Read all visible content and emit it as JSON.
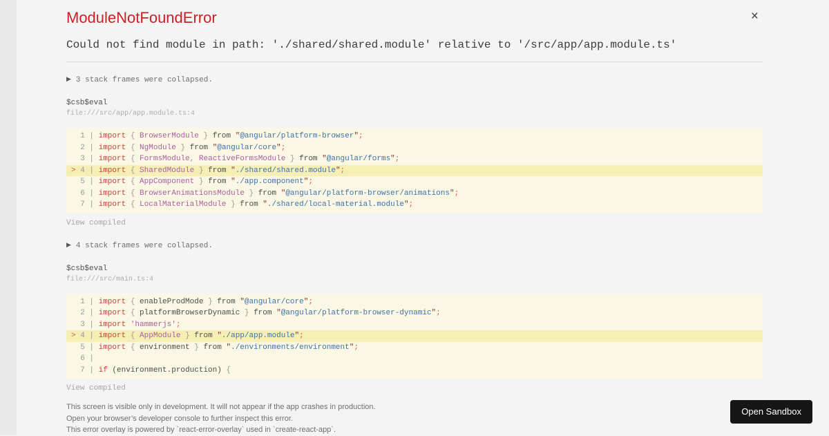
{
  "icons": {
    "collapse_arrow": "▶",
    "close": "×"
  },
  "colors": {
    "title_red": "#ca2026",
    "code_background": "#faf7e4",
    "code_highlight_line": "#f5eeb5",
    "keyword": "#c8423d",
    "type_identifier": "#a9609f",
    "string_content": "#3d72aa",
    "string_quote": "#7e3a30",
    "punctuation_red": "#e0574a",
    "button_background": "#161616"
  },
  "header": {
    "title": "ModuleNotFoundError"
  },
  "message": "Could not find module in path: './shared/shared.module' relative to '/src/app/app.module.ts'",
  "frames": [
    {
      "collapsed_note": "3 stack frames were collapsed.",
      "function_name": "$csb$eval",
      "location": "file:///src/app/app.module.ts:4",
      "view_compiled_label": "View compiled",
      "code": {
        "highlight_line": 4,
        "lines": [
          {
            "hl": false,
            "tokens": [
              [
                "g",
                "  1 | "
              ],
              [
                "k",
                "import"
              ],
              [
                "p",
                " "
              ],
              [
                "g",
                "{"
              ],
              [
                "p",
                " "
              ],
              [
                "t",
                "BrowserModule"
              ],
              [
                "p",
                " "
              ],
              [
                "g",
                "}"
              ],
              [
                "p",
                " from "
              ],
              [
                "q",
                "\""
              ],
              [
                "s",
                "@angular/platform-browser"
              ],
              [
                "q",
                "\""
              ],
              [
                "x",
                ";"
              ]
            ]
          },
          {
            "hl": false,
            "tokens": [
              [
                "g",
                "  2 | "
              ],
              [
                "k",
                "import"
              ],
              [
                "p",
                " "
              ],
              [
                "g",
                "{"
              ],
              [
                "p",
                " "
              ],
              [
                "t",
                "NgModule"
              ],
              [
                "p",
                " "
              ],
              [
                "g",
                "}"
              ],
              [
                "p",
                " from "
              ],
              [
                "q",
                "\""
              ],
              [
                "s",
                "@angular/core"
              ],
              [
                "q",
                "\""
              ],
              [
                "x",
                ";"
              ]
            ]
          },
          {
            "hl": false,
            "tokens": [
              [
                "g",
                "  3 | "
              ],
              [
                "k",
                "import"
              ],
              [
                "p",
                " "
              ],
              [
                "g",
                "{"
              ],
              [
                "p",
                " "
              ],
              [
                "t",
                "FormsModule"
              ],
              [
                "g",
                ","
              ],
              [
                "p",
                " "
              ],
              [
                "t",
                "ReactiveFormsModule"
              ],
              [
                "p",
                " "
              ],
              [
                "g",
                "}"
              ],
              [
                "p",
                " from "
              ],
              [
                "q",
                "\""
              ],
              [
                "s",
                "@angular/forms"
              ],
              [
                "q",
                "\""
              ],
              [
                "x",
                ";"
              ]
            ]
          },
          {
            "hl": true,
            "tokens": [
              [
                "x",
                "> "
              ],
              [
                "g",
                "4 | "
              ],
              [
                "k",
                "import"
              ],
              [
                "p",
                " "
              ],
              [
                "g",
                "{"
              ],
              [
                "p",
                " "
              ],
              [
                "t",
                "SharedModule"
              ],
              [
                "p",
                " "
              ],
              [
                "g",
                "}"
              ],
              [
                "p",
                " from "
              ],
              [
                "q",
                "\""
              ],
              [
                "s",
                "./shared/shared.module"
              ],
              [
                "q",
                "\""
              ],
              [
                "x",
                ";"
              ]
            ]
          },
          {
            "hl": false,
            "tokens": [
              [
                "g",
                "  5 | "
              ],
              [
                "k",
                "import"
              ],
              [
                "p",
                " "
              ],
              [
                "g",
                "{"
              ],
              [
                "p",
                " "
              ],
              [
                "t",
                "AppComponent"
              ],
              [
                "p",
                " "
              ],
              [
                "g",
                "}"
              ],
              [
                "p",
                " from "
              ],
              [
                "q",
                "\""
              ],
              [
                "s",
                "./app.component"
              ],
              [
                "q",
                "\""
              ],
              [
                "x",
                ";"
              ]
            ]
          },
          {
            "hl": false,
            "tokens": [
              [
                "g",
                "  6 | "
              ],
              [
                "k",
                "import"
              ],
              [
                "p",
                " "
              ],
              [
                "g",
                "{"
              ],
              [
                "p",
                " "
              ],
              [
                "t",
                "BrowserAnimationsModule"
              ],
              [
                "p",
                " "
              ],
              [
                "g",
                "}"
              ],
              [
                "p",
                " from "
              ],
              [
                "q",
                "\""
              ],
              [
                "s",
                "@angular/platform-browser/animations"
              ],
              [
                "q",
                "\""
              ],
              [
                "x",
                ";"
              ]
            ]
          },
          {
            "hl": false,
            "tokens": [
              [
                "g",
                "  7 | "
              ],
              [
                "k",
                "import"
              ],
              [
                "p",
                " "
              ],
              [
                "g",
                "{"
              ],
              [
                "p",
                " "
              ],
              [
                "t",
                "LocalMaterialModule"
              ],
              [
                "p",
                " "
              ],
              [
                "g",
                "}"
              ],
              [
                "p",
                " from "
              ],
              [
                "q",
                "\""
              ],
              [
                "s",
                "./shared/local-material.module"
              ],
              [
                "q",
                "\""
              ],
              [
                "x",
                ";"
              ]
            ]
          }
        ]
      }
    },
    {
      "collapsed_note": "4 stack frames were collapsed.",
      "function_name": "$csb$eval",
      "location": "file:///src/main.ts:4",
      "view_compiled_label": "View compiled",
      "code": {
        "highlight_line": 4,
        "lines": [
          {
            "hl": false,
            "tokens": [
              [
                "g",
                "  1 | "
              ],
              [
                "k",
                "import"
              ],
              [
                "p",
                " "
              ],
              [
                "g",
                "{"
              ],
              [
                "p",
                " enableProdMode "
              ],
              [
                "g",
                "}"
              ],
              [
                "p",
                " from "
              ],
              [
                "q",
                "\""
              ],
              [
                "s",
                "@angular/core"
              ],
              [
                "q",
                "\""
              ],
              [
                "x",
                ";"
              ]
            ]
          },
          {
            "hl": false,
            "tokens": [
              [
                "g",
                "  2 | "
              ],
              [
                "k",
                "import"
              ],
              [
                "p",
                " "
              ],
              [
                "g",
                "{"
              ],
              [
                "p",
                " platformBrowserDynamic "
              ],
              [
                "g",
                "}"
              ],
              [
                "p",
                " from "
              ],
              [
                "q",
                "\""
              ],
              [
                "s",
                "@angular/platform-browser-dynamic"
              ],
              [
                "q",
                "\""
              ],
              [
                "x",
                ";"
              ]
            ]
          },
          {
            "hl": false,
            "tokens": [
              [
                "g",
                "  3 | "
              ],
              [
                "k",
                "import"
              ],
              [
                "p",
                " "
              ],
              [
                "t",
                "'hammerjs'"
              ],
              [
                "x",
                ";"
              ]
            ]
          },
          {
            "hl": true,
            "tokens": [
              [
                "x",
                "> "
              ],
              [
                "g",
                "4 | "
              ],
              [
                "k",
                "import"
              ],
              [
                "p",
                " "
              ],
              [
                "g",
                "{"
              ],
              [
                "p",
                " "
              ],
              [
                "t",
                "AppModule"
              ],
              [
                "p",
                " "
              ],
              [
                "g",
                "}"
              ],
              [
                "p",
                " from "
              ],
              [
                "q",
                "\""
              ],
              [
                "s",
                "./app/app.module"
              ],
              [
                "q",
                "\""
              ],
              [
                "x",
                ";"
              ]
            ]
          },
          {
            "hl": false,
            "tokens": [
              [
                "g",
                "  5 | "
              ],
              [
                "k",
                "import"
              ],
              [
                "p",
                " "
              ],
              [
                "g",
                "{"
              ],
              [
                "p",
                " environment "
              ],
              [
                "g",
                "}"
              ],
              [
                "p",
                " from "
              ],
              [
                "q",
                "\""
              ],
              [
                "s",
                "./environments/environment"
              ],
              [
                "q",
                "\""
              ],
              [
                "x",
                ";"
              ]
            ]
          },
          {
            "hl": false,
            "tokens": [
              [
                "g",
                "  6 | "
              ]
            ]
          },
          {
            "hl": false,
            "tokens": [
              [
                "g",
                "  7 | "
              ],
              [
                "k",
                "if"
              ],
              [
                "p",
                " (environment.production) "
              ],
              [
                "g",
                "{"
              ]
            ]
          }
        ]
      }
    }
  ],
  "footer": {
    "lines": [
      "This screen is visible only in development. It will not appear if the app crashes in production.",
      "Open your browser’s developer console to further inspect this error.",
      "This error overlay is powered by `react-error-overlay` used in `create-react-app`."
    ],
    "open_sandbox_label": "Open Sandbox"
  }
}
